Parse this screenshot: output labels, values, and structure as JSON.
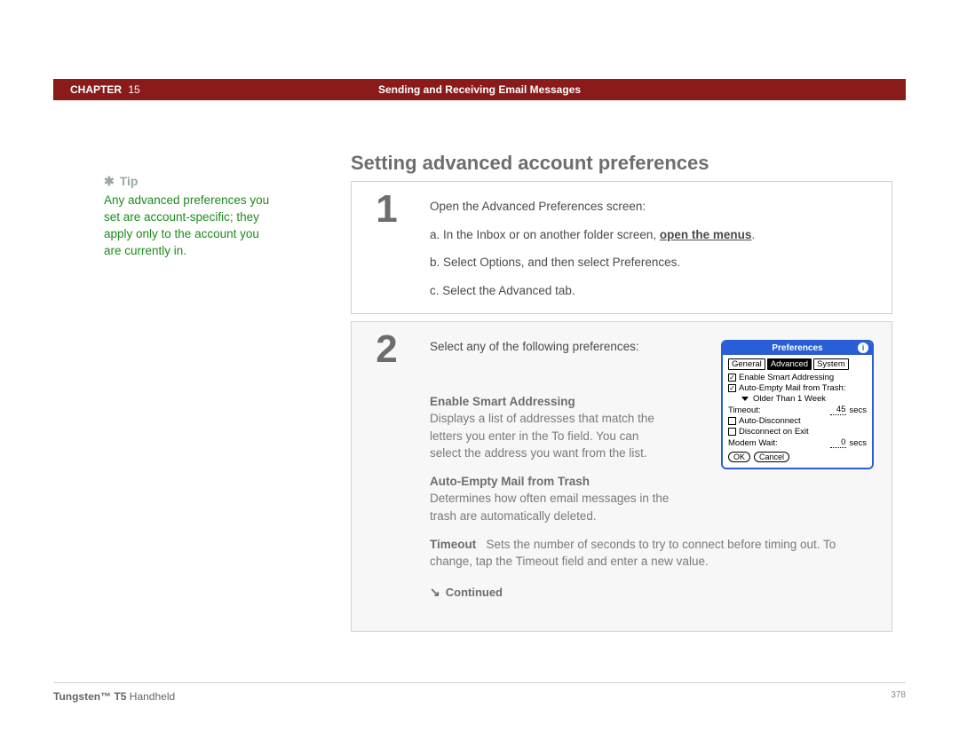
{
  "header": {
    "chapter_label": "CHAPTER",
    "chapter_number": "15",
    "title": "Sending and Receiving Email Messages"
  },
  "tip": {
    "label": "Tip",
    "text": "Any advanced preferences you set are account-specific; they apply only to the account you are currently in."
  },
  "section_title": "Setting advanced account preferences",
  "step1": {
    "number": "1",
    "intro": "Open the Advanced Preferences screen:",
    "a_prefix": "a.  In the Inbox or on another folder screen, ",
    "a_link": "open the menus",
    "a_suffix": ".",
    "b": "b.  Select Options, and then select Preferences.",
    "c": "c.  Select the Advanced tab."
  },
  "step2": {
    "number": "2",
    "intro": "Select any of the following preferences:",
    "enable_label": "Enable Smart Addressing",
    "enable_text": "Displays a list of addresses that match the letters you enter in the To field. You can select the address you want from the list.",
    "auto_empty_label": "Auto-Empty Mail from Trash",
    "auto_empty_text": "Determines how often email messages in the trash are automatically deleted.",
    "timeout_label": "Timeout",
    "timeout_text": "Sets the number of seconds to try to connect before timing out. To change, tap the Timeout field and enter a new value.",
    "continued": "Continued"
  },
  "dialog": {
    "title": "Preferences",
    "tabs": {
      "general": "General",
      "advanced": "Advanced",
      "system": "System"
    },
    "rows": {
      "enable_smart": "Enable Smart Addressing",
      "auto_empty": "Auto-Empty Mail from Trash:",
      "older_than": "Older Than 1 Week",
      "timeout_label": "Timeout:",
      "timeout_value": "45",
      "secs": "secs",
      "auto_disconnect": "Auto-Disconnect",
      "disconnect_exit": "Disconnect on Exit",
      "modem_wait_label": "Modem Wait:",
      "modem_wait_value": "0"
    },
    "ok": "OK",
    "cancel": "Cancel"
  },
  "footer": {
    "product_bold": "Tungsten™ T5",
    "product_rest": " Handheld",
    "page_number": "378"
  }
}
